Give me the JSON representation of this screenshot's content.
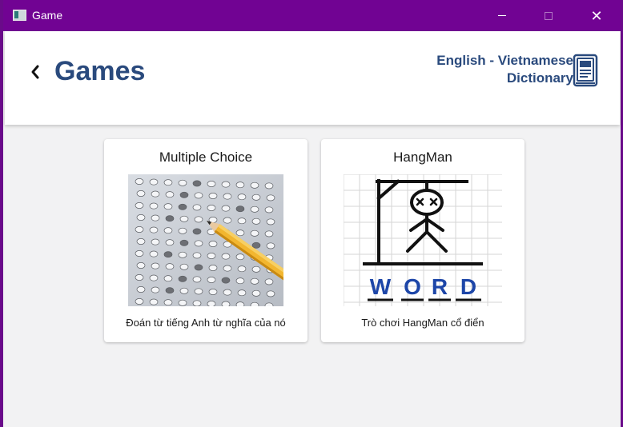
{
  "window": {
    "title": "Game",
    "controls": {
      "minimize": "minimize",
      "maximize": "maximize",
      "close": "✕"
    }
  },
  "header": {
    "back_icon": "chevron-left-icon",
    "title": "Games",
    "brand_line1": "English - Vietnamese",
    "brand_line2": "Dictionary",
    "brand_icon": "dictionary-book-icon"
  },
  "games": [
    {
      "title": "Multiple Choice",
      "description": "Đoán từ tiếng Anh từ nghĩa của nó",
      "image": "answer-sheet-pencil"
    },
    {
      "title": "HangMan",
      "description": "Trò chơi HangMan cổ điển",
      "image": "hangman-word",
      "image_word": [
        "W",
        "O",
        "R",
        "D"
      ]
    }
  ],
  "colors": {
    "titlebar": "#710393",
    "accent": "#2a4a7d",
    "background": "#f2f2f3",
    "word_blue": "#1d46a8"
  }
}
